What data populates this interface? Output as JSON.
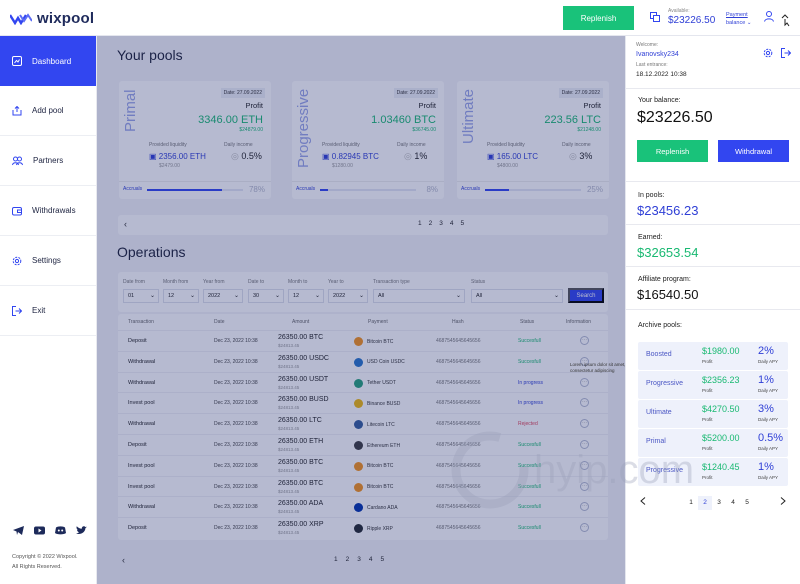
{
  "app": {
    "logo_text": "wixpool"
  },
  "topbar": {
    "replenish_label": "Replenish",
    "available_label": "Available:",
    "available_value": "$23226.50",
    "payment_balance_line1": "Payment",
    "payment_balance_line2": "balance"
  },
  "sidebar": {
    "items": [
      {
        "label": "Dashboard",
        "icon": "dashboard-icon"
      },
      {
        "label": "Add pool",
        "icon": "add-pool-icon"
      },
      {
        "label": "Partners",
        "icon": "partners-icon"
      },
      {
        "label": "Withdrawals",
        "icon": "withdrawals-icon"
      },
      {
        "label": "Settings",
        "icon": "gear-icon"
      },
      {
        "label": "Exit",
        "icon": "exit-icon"
      }
    ],
    "copyright_line1": "Copyright © 2022 Wixpool.",
    "copyright_line2": "All Rights Reserved."
  },
  "pools_title": "Your pools",
  "pools": [
    {
      "name": "Primal",
      "date": "Date: 27.09.2022",
      "profit_label": "Profit",
      "profit": "3346.00 ETH",
      "profit_sub": "$24879.00",
      "liq_label": "Provided liquidity",
      "liq": "2356.00 ETH",
      "liq_sub": "$2479.00",
      "di_label": "Daily income",
      "di": "0.5%",
      "accrual_label": "Accruals",
      "progress": 0.78,
      "progress_text": "78%"
    },
    {
      "name": "Progressive",
      "date": "Date: 27.09.2022",
      "profit_label": "Profit",
      "profit": "1.03460 BTC",
      "profit_sub": "$36745.00",
      "liq_label": "Provided liquidity",
      "liq": "0.82945 BTC",
      "liq_sub": "$1280.00",
      "di_label": "Daily income",
      "di": "1%",
      "accrual_label": "Accruals",
      "progress": 0.08,
      "progress_text": "8%"
    },
    {
      "name": "Ultimate",
      "date": "Date: 27.09.2022",
      "profit_label": "Profit",
      "profit": "223.56 LTC",
      "profit_sub": "$21248.00",
      "liq_label": "Provided liquidity",
      "liq": "165.00 LTC",
      "liq_sub": "$4800.00",
      "di_label": "Daily income",
      "di": "3%",
      "accrual_label": "Accruals",
      "progress": 0.25,
      "progress_text": "25%"
    }
  ],
  "pools_pages": [
    "1",
    "2",
    "3",
    "4",
    "5"
  ],
  "operations": {
    "title": "Operations",
    "filters": [
      {
        "label": "Date from",
        "value": "01"
      },
      {
        "label": "Month from",
        "value": "12"
      },
      {
        "label": "Year from",
        "value": "2022"
      },
      {
        "label": "Date to",
        "value": "30"
      },
      {
        "label": "Month to",
        "value": "12"
      },
      {
        "label": "Year to",
        "value": "2022"
      },
      {
        "label": "Transaction type",
        "value": "All"
      },
      {
        "label": "Status",
        "value": "All"
      }
    ],
    "search_label": "Search",
    "columns": [
      "Transaction",
      "Date",
      "Amount",
      "Payment",
      "Hash",
      "Status",
      "Information"
    ],
    "rows": [
      {
        "type": "Deposit",
        "date": "Dec 23, 2022 10:38",
        "amount": "26350.00 BTC",
        "amount_sub": "$24813.45",
        "payment": "Bitcoin BTC",
        "coin_color": "#f7931a",
        "hash": "4687545645645656",
        "status": "Succesfull",
        "status_color": "#19b972"
      },
      {
        "type": "Withdrawal",
        "date": "Dec 23, 2022 10:38",
        "amount": "26350.00 USDC",
        "amount_sub": "$24813.45",
        "payment": "USD Coin USDC",
        "coin_color": "#2775ca",
        "hash": "4687545645645656",
        "status": "Succesfull",
        "status_color": "#19b972"
      },
      {
        "type": "Withdrawal",
        "date": "Dec 23, 2022 10:38",
        "amount": "26350.00 USDT",
        "amount_sub": "$24813.45",
        "payment": "Tether USDT",
        "coin_color": "#26a17b",
        "hash": "4687545645645656",
        "status": "In progress",
        "status_color": "#2f3fd6"
      },
      {
        "type": "Invest pool",
        "date": "Dec 23, 2022 10:38",
        "amount": "26350.00 BUSD",
        "amount_sub": "$24813.45",
        "payment": "Binance BUSD",
        "coin_color": "#f0b90b",
        "hash": "4687545645645656",
        "status": "In progress",
        "status_color": "#2f3fd6"
      },
      {
        "type": "Withdrawal",
        "date": "Dec 23, 2022 10:38",
        "amount": "26350.00 LTC",
        "amount_sub": "$24813.45",
        "payment": "Litecoin LTC",
        "coin_color": "#345d9d",
        "hash": "4687545645645656",
        "status": "Rejected",
        "status_color": "#e0455a"
      },
      {
        "type": "Deposit",
        "date": "Dec 23, 2022 10:38",
        "amount": "26350.00 ETH",
        "amount_sub": "$24813.45",
        "payment": "Ethereum ETH",
        "coin_color": "#3c3c3d",
        "hash": "4687545645645656",
        "status": "Succesfull",
        "status_color": "#19b972"
      },
      {
        "type": "Invest pool",
        "date": "Dec 23, 2022 10:38",
        "amount": "26350.00 BTC",
        "amount_sub": "$24813.45",
        "payment": "Bitcoin BTC",
        "coin_color": "#f7931a",
        "hash": "4687545645645656",
        "status": "Succesfull",
        "status_color": "#19b972"
      },
      {
        "type": "Invest pool",
        "date": "Dec 23, 2022 10:38",
        "amount": "26350.00 BTC",
        "amount_sub": "$24813.45",
        "payment": "Bitcoin BTC",
        "coin_color": "#f7931a",
        "hash": "4687545645645656",
        "status": "Succesfull",
        "status_color": "#19b972"
      },
      {
        "type": "Withdrawal",
        "date": "Dec 23, 2022 10:38",
        "amount": "26350.00 ADA",
        "amount_sub": "$24813.45",
        "payment": "Cardano ADA",
        "coin_color": "#0033ad",
        "hash": "4687545645645656",
        "status": "Succesfull",
        "status_color": "#19b972"
      },
      {
        "type": "Deposit",
        "date": "Dec 23, 2022 10:38",
        "amount": "26350.00 XRP",
        "amount_sub": "$24813.45",
        "payment": "Ripple XRP",
        "coin_color": "#23292f",
        "hash": "4687545645645656",
        "status": "Succesfull",
        "status_color": "#19b972"
      }
    ],
    "tooltip": "Lorem ipsum dolor sit amet, consectetur adipiscing",
    "pages": [
      "1",
      "2",
      "3",
      "4",
      "5"
    ]
  },
  "panel": {
    "welcome_label": "Welcome:",
    "username": "Ivanovsky234",
    "last_entrance_label": "Last entrance:",
    "last_entrance": "18.12.2022 10:38",
    "balance_label": "Your balance:",
    "balance": "$23226.50",
    "replenish_label": "Replenish",
    "withdrawal_label": "Withdrawal",
    "in_pools_label": "In pools:",
    "in_pools": "$23456.23",
    "earned_label": "Earned:",
    "earned": "$32653.54",
    "affiliate_label": "Affiliate program:",
    "affiliate": "$16540.50",
    "archive_label": "Archive pools:",
    "archive": [
      {
        "name": "Boosted",
        "profit": "$1980.00",
        "profit_label": "Profit",
        "apy": "2%",
        "apy_label": "Daily APY"
      },
      {
        "name": "Progressive",
        "profit": "$2356.23",
        "profit_label": "Profit",
        "apy": "1%",
        "apy_label": "Daily APY"
      },
      {
        "name": "Ultimate",
        "profit": "$4270.50",
        "profit_label": "Profit",
        "apy": "3%",
        "apy_label": "Daily APY"
      },
      {
        "name": "Primal",
        "profit": "$5200.00",
        "profit_label": "Profit",
        "apy": "0.5%",
        "apy_label": "Daily APY"
      },
      {
        "name": "Progressive",
        "profit": "$1240.45",
        "profit_label": "Profit",
        "apy": "1%",
        "apy_label": "Daily APY"
      }
    ],
    "pages": [
      "1",
      "2",
      "3",
      "4",
      "5"
    ],
    "current_page": "2"
  },
  "watermark_text": "hyip.com",
  "colors": {
    "accent": "#3246f0",
    "green": "#19c27a",
    "reject": "#e0455a"
  }
}
